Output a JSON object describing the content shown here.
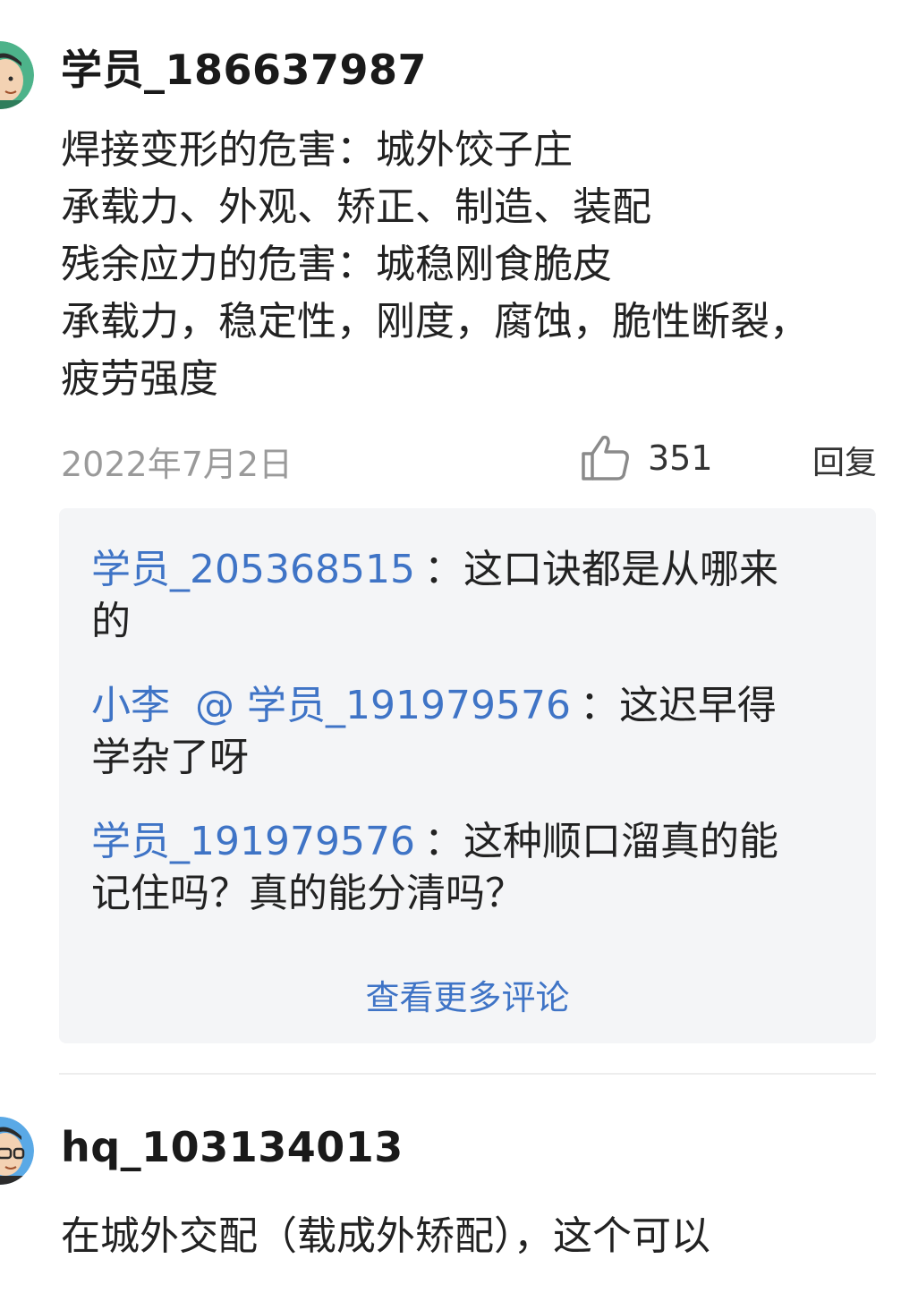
{
  "comment1": {
    "username": "学员_186637987",
    "lines": [
      "焊接变形的危害：城外饺子庄",
      "承载力、外观、矫正、制造、装配",
      "残余应力的危害：城稳刚食脆皮",
      "承载力，稳定性，刚度，腐蚀，脆性断裂，",
      "疲劳强度"
    ],
    "date": "2022年7月2日",
    "likes": "351",
    "reply_label": "回复",
    "avatar_icon": "cartoon-man-avatar"
  },
  "replies": {
    "items": [
      {
        "user": "学员_205368515",
        "mention": "",
        "sep": "：",
        "text_line1": "这口诀都是从哪来",
        "text_line2": "的"
      },
      {
        "user": "小李",
        "mention": "@ 学员_191979576",
        "sep": "：",
        "text_line1": "这迟早得",
        "text_line2": "学杂了呀"
      },
      {
        "user": "学员_191979576",
        "mention": "",
        "sep": "：",
        "text_line1": "这种顺口溜真的能",
        "text_line2": "记住吗？真的能分清吗？"
      }
    ],
    "more_label": "查看更多评论"
  },
  "comment2": {
    "username": "hq_103134013",
    "text": "在城外交配（载成外矫配），这个可以",
    "avatar_icon": "cartoon-man-glasses-avatar"
  },
  "colors": {
    "link_blue": "#3f74c6",
    "reply_bg": "#f4f5f7",
    "date_gray": "#9a9a9a",
    "avatar_green": "#4db38a",
    "avatar_blue": "#5aa9e6"
  }
}
